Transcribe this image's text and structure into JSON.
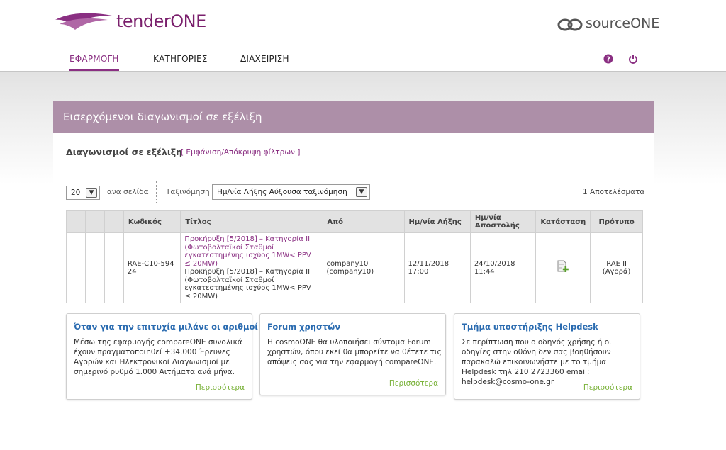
{
  "brand": {
    "left_logo_plain": "tender",
    "left_logo_bold": "ONE",
    "right_logo_plain": "source",
    "right_logo_bold": "ONE",
    "accent_color": "#8a2f82"
  },
  "nav": {
    "items": [
      {
        "label": "ΕΦΑΡΜΟΓΗ",
        "active": true
      },
      {
        "label": "ΚΑΤΗΓΟΡΙΕΣ",
        "active": false
      },
      {
        "label": "ΔΙΑΧΕΙΡΙΣΗ",
        "active": false
      }
    ],
    "icons": [
      "help-icon",
      "power-icon"
    ]
  },
  "panel": {
    "title": "Εισερχόμενοι διαγωνισμοί σε εξέλιξη",
    "section_title": "Διαγωνισμοί σε εξέλιξη",
    "filter_toggle": "[ Εμφάνιση/Απόκρυψη φίλτρων ]",
    "page_size_value": "20",
    "per_page_label": "ανα σελίδα",
    "sort_label": "Ταξινόμηση",
    "sort_value": "Ημ/νία Λήξης Αύξουσα ταξινόμηση",
    "results": "1 Αποτελέσματα"
  },
  "table": {
    "headers": [
      "",
      "",
      "",
      "Κωδικός",
      "Τίτλος",
      "Από",
      "Ημ/νία Λήξης",
      "Ημ/νία Αποστολής",
      "Κατάσταση",
      "Πρότυπο"
    ],
    "rows": [
      {
        "code": "RAE-C10-59424",
        "title_link": "Προκήρυξη [5/2018] – Κατηγορία ΙΙ (Φωτοβολταϊκοί Σταθμοί εγκατεστημένης ισχύος 1MW< PPV ≤ 20MW)",
        "title_text": "Προκήρυξη [5/2018] – Κατηγορία ΙΙ (Φωτοβολταϊκοί Σταθμοί εγκατεστημένης ισχύος 1MW< PPV ≤ 20MW)",
        "from": "company10 (company10)",
        "due_date": "12/11/2018 17:00",
        "sent_date": "24/10/2018 11:44",
        "status_icon": "add-document-icon",
        "template": "RAE II (Αγορά)"
      }
    ]
  },
  "cards": [
    {
      "title": "Όταν για την επιτυχία μιλάνε οι αριθμοί",
      "body": "Μέσω της εφαρμογής compareONE συνολικά έχουν πραγματοποιηθεί +34.000 Έρευνες Αγορών και Ηλεκτρονικοί Διαγωνισμοί με σημερινό ρυθμό 1.000 Αιτήματα ανά μήνα.",
      "more": "Περισσότερα"
    },
    {
      "title": "Forum χρηστών",
      "body": "Η cosmoONE θα υλοποιήσει σύντομα Forum χρηστών, όπου εκεί θα μπορείτε να θέτετε τις απόψεις σας για την εφαρμογή compareONE.",
      "more": "Περισσότερα"
    },
    {
      "title": "Τμήμα υποστήριξης Helpdesk",
      "body": "Σε περίπτωση που ο οδηγός χρήσης ή οι οδηγίες στην οθόνη δεν σας βοηθήσουν παρακαλώ επικοινωνήστε με το τμήμα Helpdesk τηλ 210 2723360 email: helpdesk@cosmo-one.gr",
      "more": "Περισσότερα"
    }
  ]
}
